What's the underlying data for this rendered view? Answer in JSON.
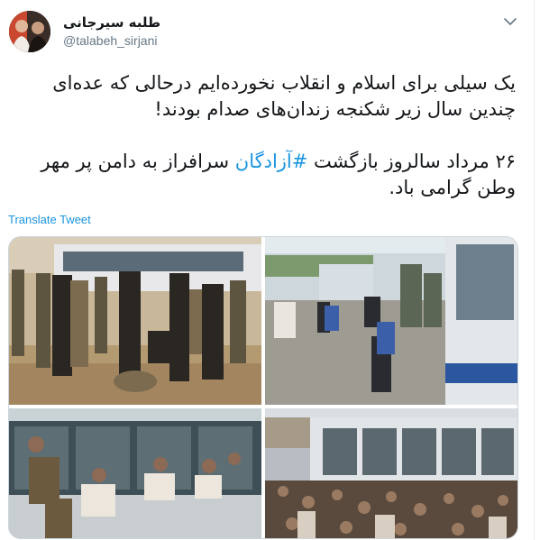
{
  "author": {
    "display_name": "طلبه سیرجانی",
    "handle": "@talabeh_sirjani",
    "avatar_icon": "profile-photo-icon"
  },
  "menu": {
    "icon": "chevron-down-icon"
  },
  "tweet": {
    "line1": "یک سیلی برای اسلام و انقلاب نخورده‌ایم درحالی که عده‌ای چندین سال زیر شکنجه زندان‌های صدام بودند!",
    "line2_before": "۲۶ مرداد سالروز بازگشت ",
    "hashtag": "#آزادگان",
    "line2_after": " سرافراز به دامن پر مهر وطن گرامی باد."
  },
  "translate_label": "Translate Tweet",
  "colors": {
    "link": "#1b95e0",
    "text": "#14171a",
    "muted": "#657786",
    "border": "#ccd6dd"
  }
}
